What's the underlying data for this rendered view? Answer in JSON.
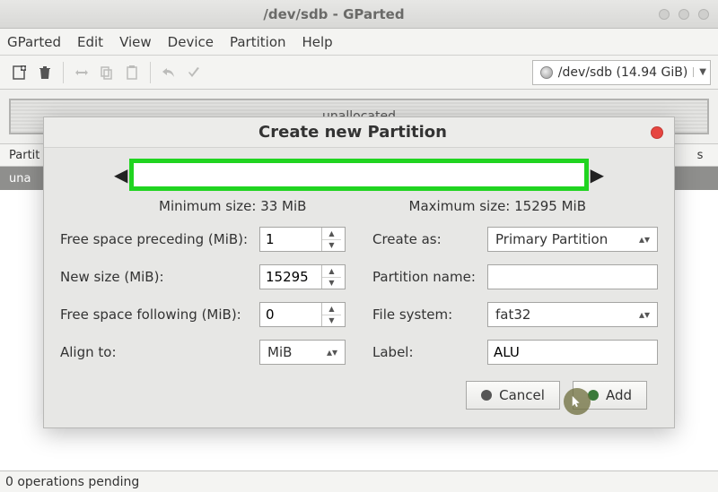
{
  "titlebar": {
    "title": "/dev/sdb - GParted"
  },
  "menu": {
    "items": [
      "GParted",
      "Edit",
      "View",
      "Device",
      "Partition",
      "Help"
    ]
  },
  "device_selector": {
    "label": "/dev/sdb  (14.94 GiB)"
  },
  "strip": {
    "label": "unallocated"
  },
  "table": {
    "headers": {
      "first": "Partit",
      "last": "s"
    },
    "row0": "una"
  },
  "dialog": {
    "title": "Create new Partition",
    "min_size": "Minimum size: 33 MiB",
    "max_size": "Maximum size: 15295 MiB",
    "labels": {
      "free_preceding": "Free space preceding (MiB):",
      "new_size": "New size (MiB):",
      "free_following": "Free space following (MiB):",
      "align_to": "Align to:",
      "create_as": "Create as:",
      "partition_name": "Partition name:",
      "file_system": "File system:",
      "label": "Label:"
    },
    "values": {
      "free_preceding": "1",
      "new_size": "15295",
      "free_following": "0",
      "align_to": "MiB",
      "create_as": "Primary Partition",
      "partition_name": "",
      "file_system": "fat32",
      "label": "ALU"
    },
    "buttons": {
      "cancel": "Cancel",
      "add": "Add"
    }
  },
  "statusbar": {
    "text": "0 operations pending"
  }
}
